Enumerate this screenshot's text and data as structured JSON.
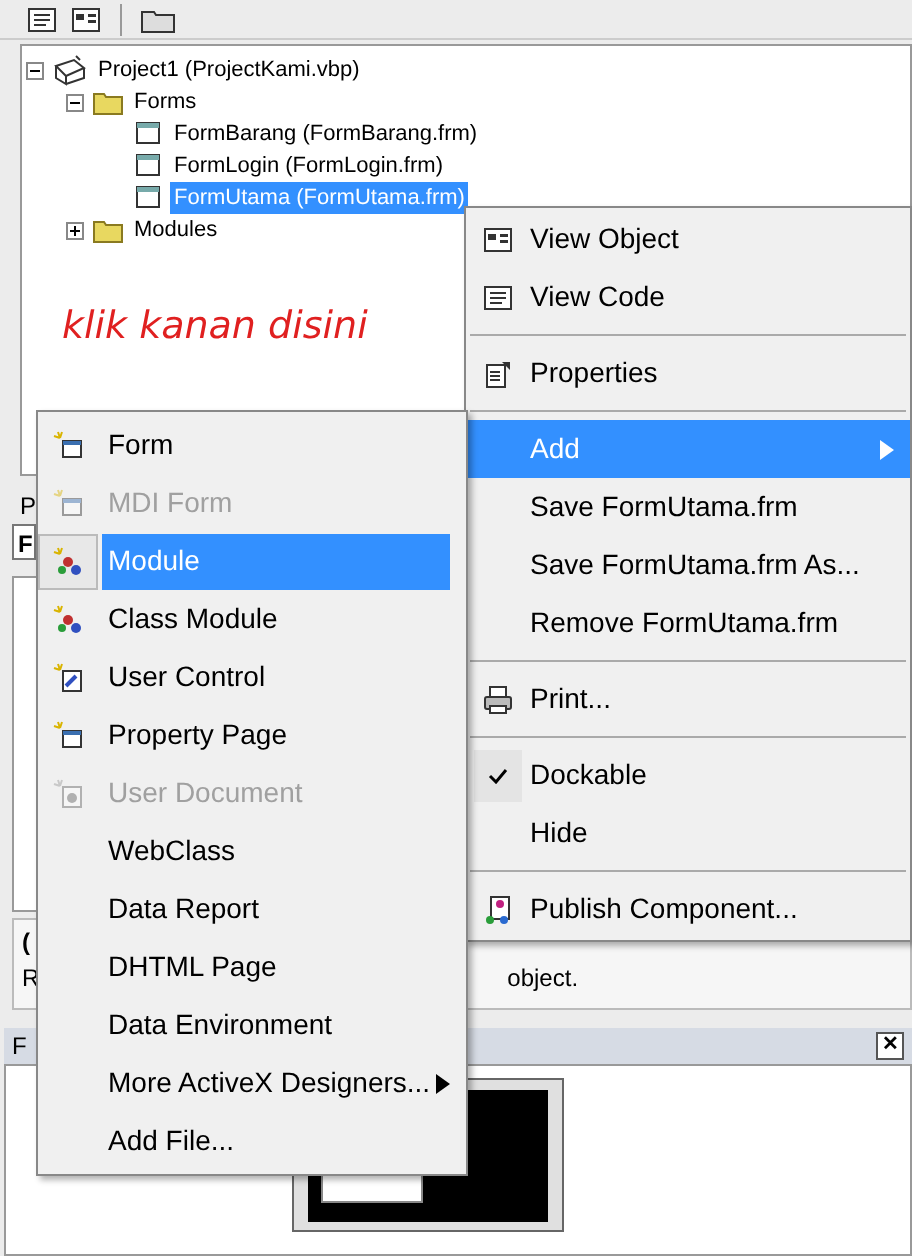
{
  "project_tree": {
    "label": "Project1 (ProjectKami.vbp)",
    "expanded": true,
    "children": [
      {
        "label": "Forms",
        "expanded": true,
        "children": [
          {
            "label": "FormBarang (FormBarang.frm)",
            "selected": false
          },
          {
            "label": "FormLogin (FormLogin.frm)",
            "selected": false
          },
          {
            "label": "FormUtama (FormUtama.frm)",
            "selected": true
          }
        ]
      },
      {
        "label": "Modules",
        "expanded": false
      }
    ]
  },
  "annotation": "klik kanan disini",
  "properties_panel": {
    "title": "P",
    "object_box": "F",
    "description_title": "(",
    "description_start": "R",
    "description_end": "object."
  },
  "form_layout": {
    "title": "F",
    "close": "✕"
  },
  "context_menu": [
    {
      "kind": "item",
      "label": "View Object",
      "selected": false
    },
    {
      "kind": "item",
      "label": "View Code",
      "selected": false
    },
    {
      "kind": "separator"
    },
    {
      "kind": "item",
      "label": "Properties",
      "selected": false
    },
    {
      "kind": "separator"
    },
    {
      "kind": "submenu",
      "label": "Add",
      "selected": true
    },
    {
      "kind": "item",
      "label": "Save FormUtama.frm",
      "selected": false
    },
    {
      "kind": "item",
      "label": "Save FormUtama.frm As...",
      "selected": false
    },
    {
      "kind": "item",
      "label": "Remove FormUtama.frm",
      "selected": false
    },
    {
      "kind": "separator"
    },
    {
      "kind": "item",
      "label": "Print...",
      "selected": false
    },
    {
      "kind": "separator"
    },
    {
      "kind": "check",
      "label": "Dockable",
      "checked": true,
      "selected": false
    },
    {
      "kind": "item",
      "label": "Hide",
      "selected": false
    },
    {
      "kind": "separator"
    },
    {
      "kind": "item",
      "label": "Publish Component...",
      "selected": false
    }
  ],
  "add_submenu": [
    {
      "kind": "item",
      "label": "Form",
      "disabled": false,
      "selected": false
    },
    {
      "kind": "item",
      "label": "MDI Form",
      "disabled": true,
      "selected": false
    },
    {
      "kind": "item",
      "label": "Module",
      "disabled": false,
      "selected": true
    },
    {
      "kind": "item",
      "label": "Class Module",
      "disabled": false,
      "selected": false
    },
    {
      "kind": "item",
      "label": "User Control",
      "disabled": false,
      "selected": false
    },
    {
      "kind": "item",
      "label": "Property Page",
      "disabled": false,
      "selected": false
    },
    {
      "kind": "item",
      "label": "User Document",
      "disabled": true,
      "selected": false
    },
    {
      "kind": "item",
      "label": "WebClass",
      "disabled": false,
      "selected": false
    },
    {
      "kind": "item",
      "label": "Data Report",
      "disabled": false,
      "selected": false
    },
    {
      "kind": "item",
      "label": "DHTML Page",
      "disabled": false,
      "selected": false
    },
    {
      "kind": "item",
      "label": "Data Environment",
      "disabled": false,
      "selected": false
    },
    {
      "kind": "submenu",
      "label": "More ActiveX Designers...",
      "disabled": false,
      "selected": false
    },
    {
      "kind": "item",
      "label": "Add File...",
      "disabled": false,
      "selected": false
    }
  ]
}
